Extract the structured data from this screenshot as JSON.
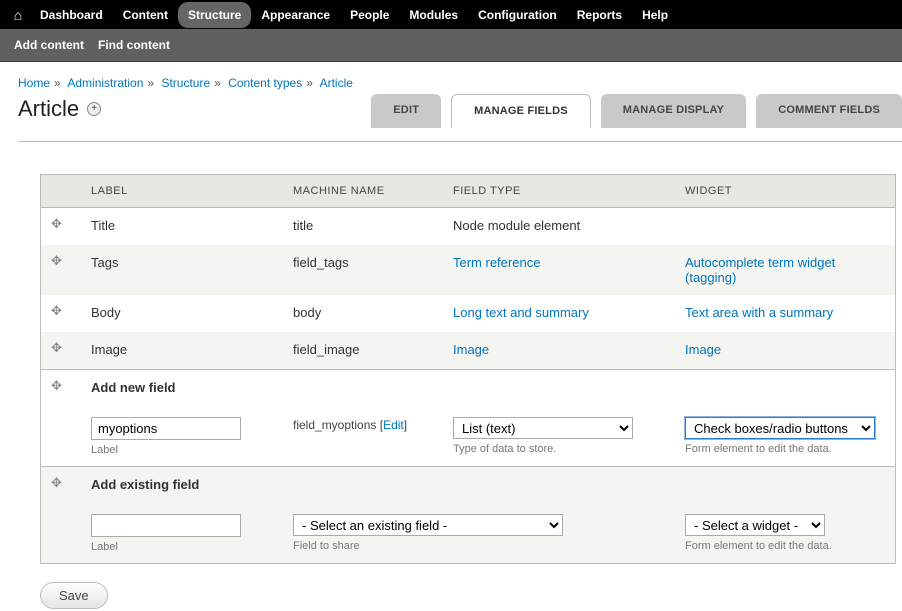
{
  "topnav": {
    "items": [
      {
        "name": "dashboard",
        "label": "Dashboard"
      },
      {
        "name": "content",
        "label": "Content"
      },
      {
        "name": "structure",
        "label": "Structure",
        "active": true
      },
      {
        "name": "appearance",
        "label": "Appearance"
      },
      {
        "name": "people",
        "label": "People"
      },
      {
        "name": "modules",
        "label": "Modules"
      },
      {
        "name": "configuration",
        "label": "Configuration"
      },
      {
        "name": "reports",
        "label": "Reports"
      },
      {
        "name": "help",
        "label": "Help"
      }
    ]
  },
  "subnav": {
    "add_content": "Add content",
    "find_content": "Find content"
  },
  "breadcrumb": [
    "Home",
    "Administration",
    "Structure",
    "Content types",
    "Article"
  ],
  "page_title": "Article",
  "tabs": {
    "edit": "EDIT",
    "manage_fields": "MANAGE FIELDS",
    "manage_display": "MANAGE DISPLAY",
    "comment_fields": "COMMENT FIELDS"
  },
  "columns": {
    "label": "LABEL",
    "machine": "MACHINE NAME",
    "ftype": "FIELD TYPE",
    "widget": "WIDGET"
  },
  "rows": [
    {
      "label": "Title",
      "machine": "title",
      "ftype": "Node module element",
      "ftype_link": false,
      "widget": "",
      "widget_link": false
    },
    {
      "label": "Tags",
      "machine": "field_tags",
      "ftype": "Term reference",
      "ftype_link": true,
      "widget": "Autocomplete term widget (tagging)",
      "widget_link": true
    },
    {
      "label": "Body",
      "machine": "body",
      "ftype": "Long text and summary",
      "ftype_link": true,
      "widget": "Text area with a summary",
      "widget_link": true
    },
    {
      "label": "Image",
      "machine": "field_image",
      "ftype": "Image",
      "ftype_link": true,
      "widget": "Image",
      "widget_link": true
    }
  ],
  "add_new": {
    "heading": "Add new field",
    "label_value": "myoptions",
    "label_help": "Label",
    "machine_prefix": "field_",
    "machine_value": "myoptions",
    "edit_link": "Edit",
    "ftype_value": "List (text)",
    "ftype_help": "Type of data to store.",
    "widget_value": "Check boxes/radio buttons",
    "widget_help": "Form element to edit the data."
  },
  "add_existing": {
    "heading": "Add existing field",
    "label_value": "",
    "label_help": "Label",
    "field_value": "- Select an existing field -",
    "field_help": "Field to share",
    "widget_value": "- Select a widget -",
    "widget_help": "Form element to edit the data."
  },
  "save_label": "Save"
}
